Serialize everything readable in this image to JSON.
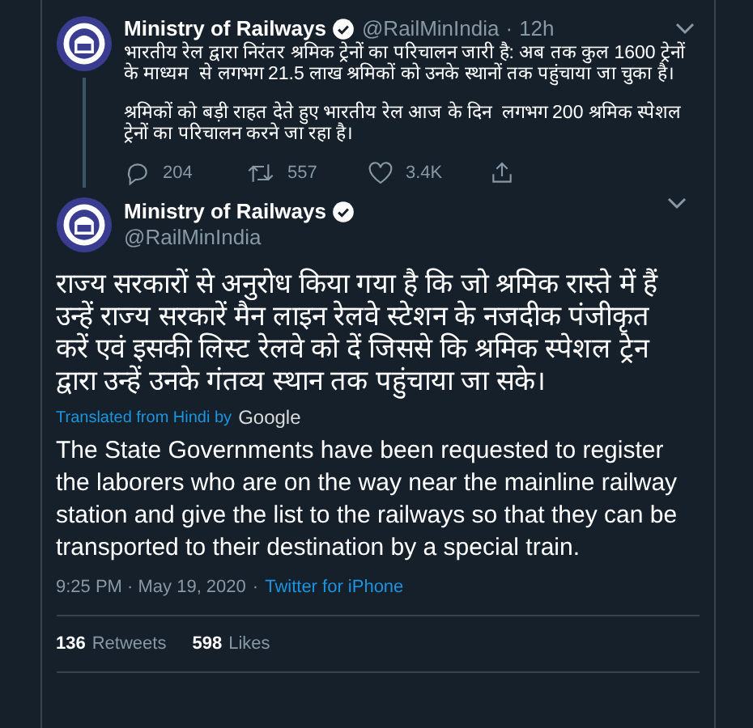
{
  "reply_tweet": {
    "name": "Ministry of Railways",
    "handle": "@RailMinIndia",
    "time": "12h",
    "paragraphs": [
      "भारतीय रेल द्वारा निरंतर श्रमिक ट्रेनों का परिचालन जारी है: अब तक कुल 1600 ट्रेनों के माध्यम  से लगभग 21.5 लाख श्रमिकों को उनके स्थानों तक पहुंचाया जा चुका है।",
      "श्रमिकों को बड़ी राहत देते हुए भारतीय रेल आज के दिन  लगभग 200 श्रमिक स्पेशल ट्रेनों का परिचालन करने जा रहा है।"
    ],
    "actions": [
      {
        "kind": "reply",
        "count": "204"
      },
      {
        "kind": "retweet",
        "count": "557"
      },
      {
        "kind": "like",
        "count": "3.4K"
      },
      {
        "kind": "share"
      }
    ]
  },
  "main_tweet": {
    "name": "Ministry of Railways",
    "handle": "@RailMinIndia",
    "text": "राज्य सरकारों से अनुरोध किया गया है कि जो श्रमिक रास्ते में हैं उन्हें राज्य सरकारें मैन लाइन रेलवे स्टेशन के नजदीक पंजीकृत करें एवं इसकी लिस्ट रेलवे को दें जिससे कि श्रमिक स्पेशल ट्रेन द्वारा उन्हें उनके गंतव्य स्थान तक पहुंचाया जा सके।",
    "translated_label": "Translated from Hindi by",
    "translator": "Google",
    "translation": "The State Governments have been requested to register the laborers who are on the way near the mainline railway station and give the list to the railways so that they can be transported to their destination by a special train.",
    "timestamp": "9:25 PM · May 19, 2020",
    "separator": "·",
    "source": "Twitter for iPhone",
    "stats": [
      {
        "count": "136",
        "label": "Retweets"
      },
      {
        "count": "598",
        "label": "Likes"
      }
    ]
  }
}
